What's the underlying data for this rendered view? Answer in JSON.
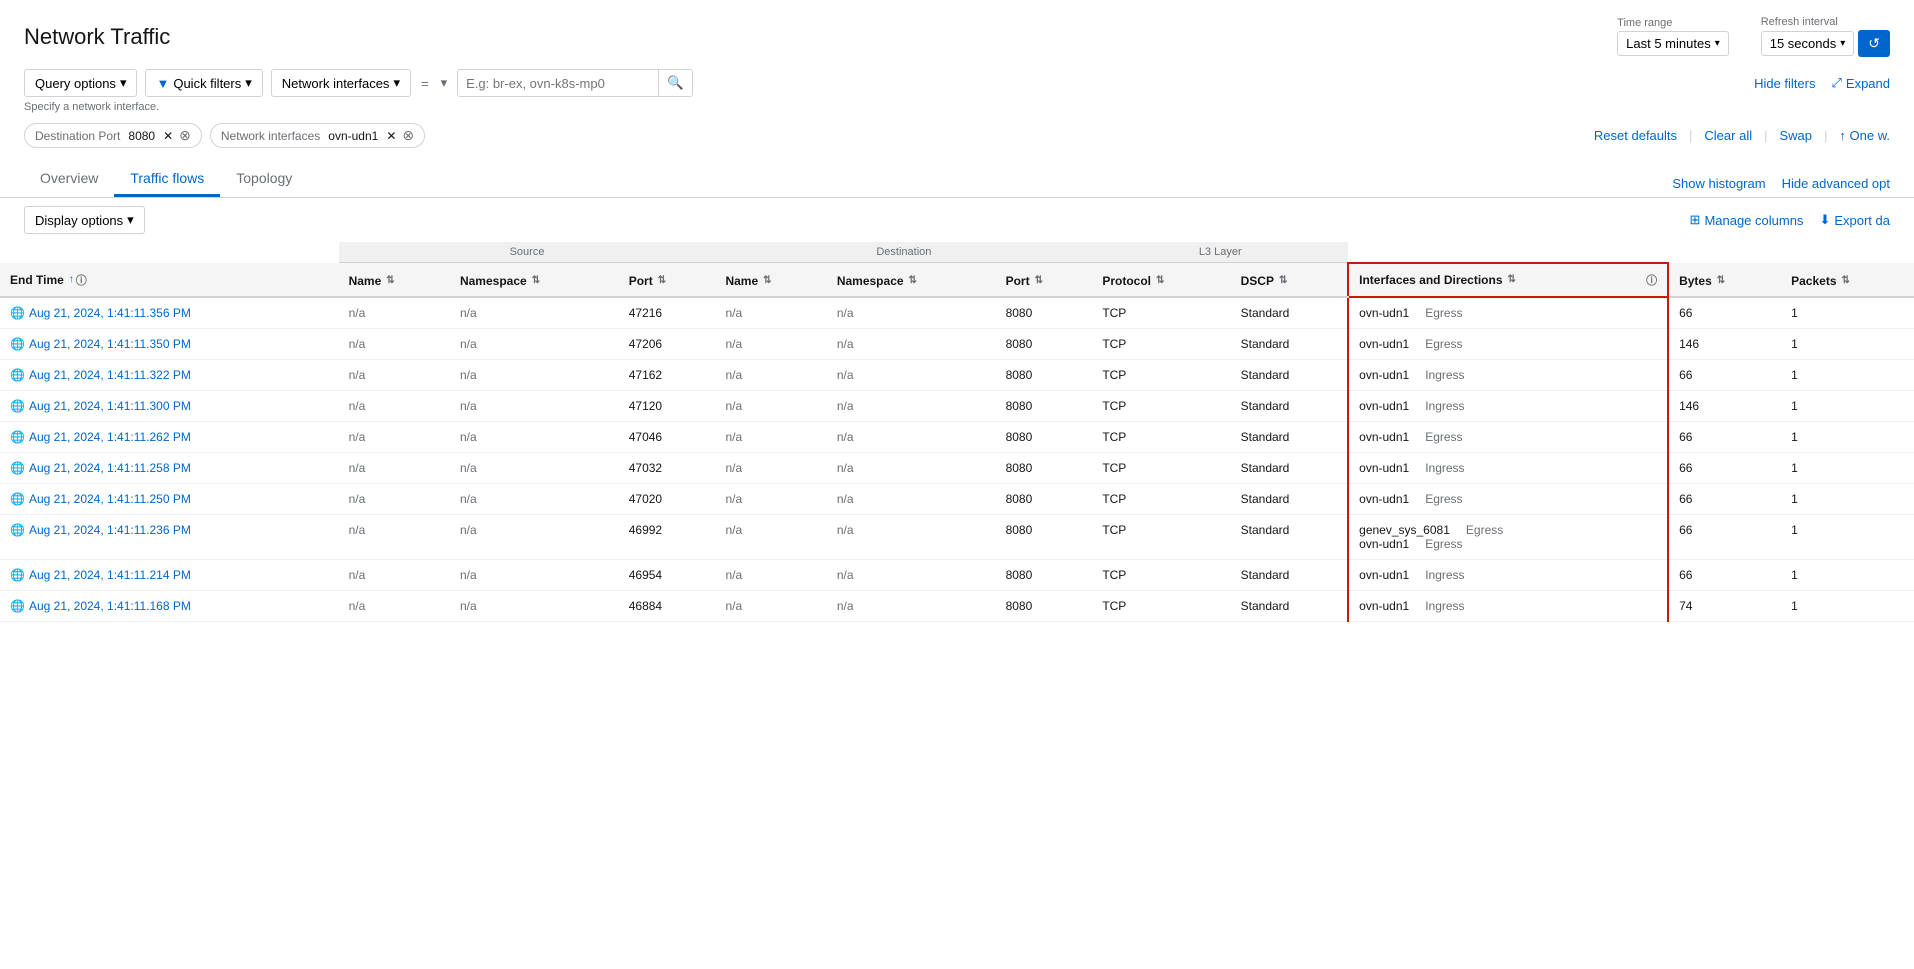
{
  "app": {
    "title": "Network Traffic"
  },
  "header": {
    "time_range_label": "Time range",
    "time_range_value": "Last 5 minutes",
    "refresh_label": "Refresh interval",
    "refresh_value": "15 seconds",
    "refresh_btn": "↺"
  },
  "filter_bar": {
    "query_options_label": "Query options",
    "quick_filters_label": "Quick filters",
    "network_interfaces_label": "Network interfaces",
    "eq_label": "=",
    "search_placeholder": "E.g: br-ex, ovn-k8s-mp0",
    "hint": "Specify a network interface.",
    "hide_filters_label": "Hide filters",
    "expand_label": "Expand"
  },
  "active_filters": {
    "filters": [
      {
        "label": "Destination Port",
        "value": "8080"
      },
      {
        "label": "Network interfaces",
        "value": "ovn-udn1"
      }
    ],
    "reset_label": "Reset defaults",
    "clear_label": "Clear all",
    "swap_label": "Swap",
    "one_label": "One w."
  },
  "tabs": {
    "items": [
      {
        "label": "Overview",
        "active": false
      },
      {
        "label": "Traffic flows",
        "active": true
      },
      {
        "label": "Topology",
        "active": false
      }
    ],
    "show_histogram": "Show histogram",
    "hide_advanced": "Hide advanced opt"
  },
  "display": {
    "label": "Display options",
    "manage_columns": "Manage columns",
    "export_data": "Export da"
  },
  "table": {
    "group_headers": [
      {
        "label": "",
        "colspan": 1
      },
      {
        "label": "Source",
        "colspan": 3
      },
      {
        "label": "Destination",
        "colspan": 3
      },
      {
        "label": "L3 Layer",
        "colspan": 2
      },
      {
        "label": "",
        "colspan": 3
      }
    ],
    "columns": [
      {
        "label": "End Time",
        "sortable": true,
        "sort_dir": "asc",
        "info": true
      },
      {
        "label": "Name",
        "sortable": true
      },
      {
        "label": "Namespace",
        "sortable": true
      },
      {
        "label": "Port",
        "sortable": true
      },
      {
        "label": "Name",
        "sortable": true
      },
      {
        "label": "Namespace",
        "sortable": true
      },
      {
        "label": "Port",
        "sortable": true
      },
      {
        "label": "Protocol",
        "sortable": true
      },
      {
        "label": "DSCP",
        "sortable": true
      },
      {
        "label": "Interfaces and Directions",
        "sortable": true,
        "info": true,
        "highlighted": true
      },
      {
        "label": "Bytes",
        "sortable": true
      },
      {
        "label": "Packets",
        "sortable": true
      }
    ],
    "rows": [
      {
        "end_time": "Aug 21, 2024, 1:41:11.356 PM",
        "src_name": "n/a",
        "src_ns": "n/a",
        "src_port": "47216",
        "dst_name": "n/a",
        "dst_ns": "n/a",
        "dst_port": "8080",
        "protocol": "TCP",
        "dscp": "Standard",
        "iface": "ovn-udn1",
        "direction": "Egress",
        "bytes": "66",
        "packets": "1"
      },
      {
        "end_time": "Aug 21, 2024, 1:41:11.350 PM",
        "src_name": "n/a",
        "src_ns": "n/a",
        "src_port": "47206",
        "dst_name": "n/a",
        "dst_ns": "n/a",
        "dst_port": "8080",
        "protocol": "TCP",
        "dscp": "Standard",
        "iface": "ovn-udn1",
        "direction": "Egress",
        "bytes": "146",
        "packets": "1"
      },
      {
        "end_time": "Aug 21, 2024, 1:41:11.322 PM",
        "src_name": "n/a",
        "src_ns": "n/a",
        "src_port": "47162",
        "dst_name": "n/a",
        "dst_ns": "n/a",
        "dst_port": "8080",
        "protocol": "TCP",
        "dscp": "Standard",
        "iface": "ovn-udn1",
        "direction": "Ingress",
        "bytes": "66",
        "packets": "1"
      },
      {
        "end_time": "Aug 21, 2024, 1:41:11.300 PM",
        "src_name": "n/a",
        "src_ns": "n/a",
        "src_port": "47120",
        "dst_name": "n/a",
        "dst_ns": "n/a",
        "dst_port": "8080",
        "protocol": "TCP",
        "dscp": "Standard",
        "iface": "ovn-udn1",
        "direction": "Ingress",
        "bytes": "146",
        "packets": "1"
      },
      {
        "end_time": "Aug 21, 2024, 1:41:11.262 PM",
        "src_name": "n/a",
        "src_ns": "n/a",
        "src_port": "47046",
        "dst_name": "n/a",
        "dst_ns": "n/a",
        "dst_port": "8080",
        "protocol": "TCP",
        "dscp": "Standard",
        "iface": "ovn-udn1",
        "direction": "Egress",
        "bytes": "66",
        "packets": "1"
      },
      {
        "end_time": "Aug 21, 2024, 1:41:11.258 PM",
        "src_name": "n/a",
        "src_ns": "n/a",
        "src_port": "47032",
        "dst_name": "n/a",
        "dst_ns": "n/a",
        "dst_port": "8080",
        "protocol": "TCP",
        "dscp": "Standard",
        "iface": "ovn-udn1",
        "direction": "Ingress",
        "bytes": "66",
        "packets": "1"
      },
      {
        "end_time": "Aug 21, 2024, 1:41:11.250 PM",
        "src_name": "n/a",
        "src_ns": "n/a",
        "src_port": "47020",
        "dst_name": "n/a",
        "dst_ns": "n/a",
        "dst_port": "8080",
        "protocol": "TCP",
        "dscp": "Standard",
        "iface": "ovn-udn1",
        "direction": "Egress",
        "bytes": "66",
        "packets": "1"
      },
      {
        "end_time": "Aug 21, 2024, 1:41:11.236 PM",
        "src_name": "n/a",
        "src_ns": "n/a",
        "src_port": "46992",
        "dst_name": "n/a",
        "dst_ns": "n/a",
        "dst_port": "8080",
        "protocol": "TCP",
        "dscp": "Standard",
        "iface": "genev_sys_6081\novn-udn1",
        "direction": "Egress\nEgress",
        "bytes": "66",
        "packets": "1",
        "multi_iface": true,
        "ifaces": [
          {
            "name": "genev_sys_6081",
            "dir": "Egress"
          },
          {
            "name": "ovn-udn1",
            "dir": "Egress"
          }
        ]
      },
      {
        "end_time": "Aug 21, 2024, 1:41:11.214 PM",
        "src_name": "n/a",
        "src_ns": "n/a",
        "src_port": "46954",
        "dst_name": "n/a",
        "dst_ns": "n/a",
        "dst_port": "8080",
        "protocol": "TCP",
        "dscp": "Standard",
        "iface": "ovn-udn1",
        "direction": "Ingress",
        "bytes": "66",
        "packets": "1"
      },
      {
        "end_time": "Aug 21, 2024, 1:41:11.168 PM",
        "src_name": "n/a",
        "src_ns": "n/a",
        "src_port": "46884",
        "dst_name": "n/a",
        "dst_ns": "n/a",
        "dst_port": "8080",
        "protocol": "TCP",
        "dscp": "Standard",
        "iface": "ovn-udn1",
        "direction": "Ingress",
        "bytes": "74",
        "packets": "1"
      }
    ]
  }
}
